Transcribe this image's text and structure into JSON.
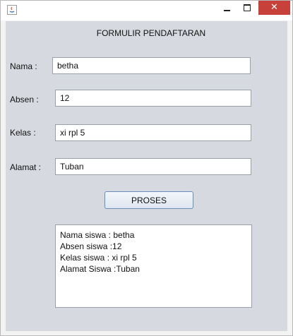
{
  "window": {
    "close_glyph": "✕"
  },
  "form": {
    "heading": "FORMULIR PENDAFTARAN",
    "fields": [
      {
        "label": "Nama :",
        "value": "betha"
      },
      {
        "label": "Absen :",
        "value": "12"
      },
      {
        "label": "Kelas :",
        "value": "xi rpl 5"
      },
      {
        "label": "Alamat :",
        "value": "Tuban"
      }
    ],
    "button_label": "PROSES",
    "output_lines": [
      "Nama siswa : betha",
      "Absen siswa :12",
      "Kelas siswa : xi rpl 5",
      "Alamat Siswa :Tuban"
    ]
  },
  "colors": {
    "panel_bg": "#d6d9df",
    "close_button": "#c7403a"
  }
}
